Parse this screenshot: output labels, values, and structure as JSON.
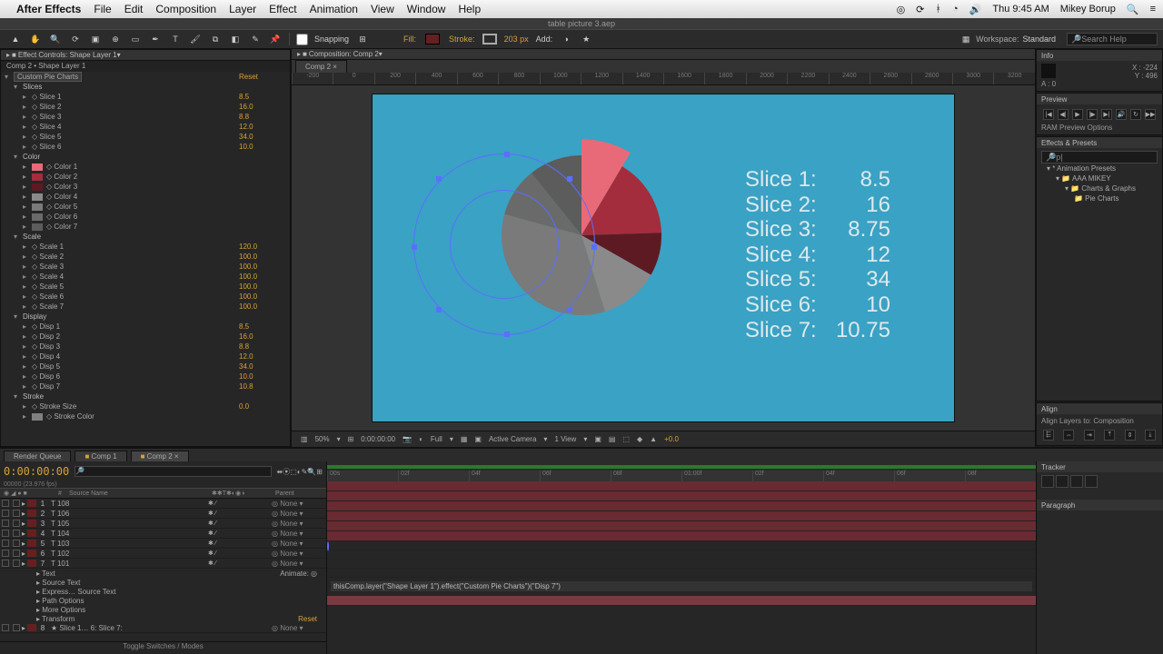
{
  "menubar": {
    "app": "After Effects",
    "items": [
      "File",
      "Edit",
      "Composition",
      "Layer",
      "Effect",
      "Animation",
      "View",
      "Window",
      "Help"
    ],
    "clock": "Thu 9:45 AM",
    "user": "Mikey Borup"
  },
  "filebar": {
    "title": "table picture 3.aep"
  },
  "toolbar": {
    "snapping": "Snapping",
    "fill": "Fill:",
    "stroke": "Stroke:",
    "stroke_px": "203 px",
    "add": "Add:",
    "workspace_lbl": "Workspace:",
    "workspace_val": "Standard",
    "search_ph": "Search Help"
  },
  "effect_controls": {
    "tab": "Effect Controls: Shape Layer 1",
    "head": "Comp 2 • Shape Layer 1",
    "effect_name": "Custom Pie Charts",
    "reset": "Reset",
    "groups": {
      "slices": {
        "label": "Slices",
        "rows": [
          {
            "name": "Slice 1",
            "val": "8.5"
          },
          {
            "name": "Slice 2",
            "val": "16.0"
          },
          {
            "name": "Slice 3",
            "val": "8.8"
          },
          {
            "name": "Slice 4",
            "val": "12.0"
          },
          {
            "name": "Slice 5",
            "val": "34.0"
          },
          {
            "name": "Slice 6",
            "val": "10.0"
          }
        ]
      },
      "colors": {
        "label": "Color",
        "rows": [
          {
            "name": "Color 1",
            "sw": "#e86a78"
          },
          {
            "name": "Color 2",
            "sw": "#a32d3c"
          },
          {
            "name": "Color 3",
            "sw": "#5d1a23"
          },
          {
            "name": "Color 4",
            "sw": "#8a8a8a"
          },
          {
            "name": "Color 5",
            "sw": "#7a7a7a"
          },
          {
            "name": "Color 6",
            "sw": "#6a6a6a"
          },
          {
            "name": "Color 7",
            "sw": "#5c5c5c"
          }
        ]
      },
      "scale": {
        "label": "Scale",
        "rows": [
          {
            "name": "Scale 1",
            "val": "120.0"
          },
          {
            "name": "Scale 2",
            "val": "100.0"
          },
          {
            "name": "Scale 3",
            "val": "100.0"
          },
          {
            "name": "Scale 4",
            "val": "100.0"
          },
          {
            "name": "Scale 5",
            "val": "100.0"
          },
          {
            "name": "Scale 6",
            "val": "100.0"
          },
          {
            "name": "Scale 7",
            "val": "100.0"
          }
        ]
      },
      "display": {
        "label": "Display",
        "rows": [
          {
            "name": "Disp 1",
            "val": "8.5"
          },
          {
            "name": "Disp 2",
            "val": "16.0"
          },
          {
            "name": "Disp 3",
            "val": "8.8"
          },
          {
            "name": "Disp 4",
            "val": "12.0"
          },
          {
            "name": "Disp 5",
            "val": "34.0"
          },
          {
            "name": "Disp 6",
            "val": "10.0"
          },
          {
            "name": "Disp 7",
            "val": "10.8"
          }
        ]
      },
      "stroke": {
        "label": "Stroke",
        "rows": [
          {
            "name": "Stroke Size",
            "val": "0.0"
          },
          {
            "name": "Stroke Color",
            "sw": "#808080"
          }
        ]
      }
    }
  },
  "comp": {
    "panel_tab": "Composition: Comp 2",
    "tab": "Comp 2",
    "ruler": [
      "-200",
      "0",
      "200",
      "400",
      "600",
      "800",
      "1000",
      "1200",
      "1400",
      "1600",
      "1800",
      "2000",
      "2200",
      "2400",
      "2600",
      "2800",
      "3000",
      "3200"
    ],
    "viewbar": {
      "zoom": "50%",
      "time": "0:00:00:00",
      "res": "Full",
      "camera": "Active Camera",
      "views": "1 View",
      "exp": "+0.0"
    }
  },
  "chart_data": {
    "type": "pie",
    "title": "",
    "series": [
      {
        "name": "Slice 1",
        "value": 8.5,
        "color": "#e86a78",
        "scale": 1.2
      },
      {
        "name": "Slice 2",
        "value": 16,
        "color": "#a32d3c",
        "scale": 1.0
      },
      {
        "name": "Slice 3",
        "value": 8.75,
        "color": "#5d1a23",
        "scale": 1.0
      },
      {
        "name": "Slice 4",
        "value": 12,
        "color": "#8a8a8a",
        "scale": 1.0
      },
      {
        "name": "Slice 5",
        "value": 34,
        "color": "#7a7a7a",
        "scale": 1.0
      },
      {
        "name": "Slice 6",
        "value": 10,
        "color": "#6a6a6a",
        "scale": 1.0
      },
      {
        "name": "Slice 7",
        "value": 10.75,
        "color": "#5c5c5c",
        "scale": 1.0
      }
    ],
    "legend": [
      {
        "label": "Slice 1:",
        "val": "8.5"
      },
      {
        "label": "Slice 2:",
        "val": "16"
      },
      {
        "label": "Slice 3:",
        "val": "8.75"
      },
      {
        "label": "Slice 4:",
        "val": "12"
      },
      {
        "label": "Slice 5:",
        "val": "34"
      },
      {
        "label": "Slice 6:",
        "val": "10"
      },
      {
        "label": "Slice 7:",
        "val": "10.75"
      }
    ]
  },
  "rightcol": {
    "info": {
      "title": "Info",
      "x": "X : -224",
      "y": "Y : 496",
      "a": "A : 0"
    },
    "preview": {
      "title": "Preview",
      "opts": "RAM Preview Options"
    },
    "effects": {
      "title": "Effects & Presets",
      "search": "p|",
      "tree": [
        {
          "l": 0,
          "t": "* Animation Presets"
        },
        {
          "l": 1,
          "t": "AAA MIKEY"
        },
        {
          "l": 2,
          "t": "Charts & Graphs"
        },
        {
          "l": 3,
          "t": "Pie Charts"
        }
      ]
    },
    "align": {
      "title": "Align",
      "lbl": "Align Layers to:",
      "val": "Composition"
    },
    "tracker": {
      "title": "Tracker"
    },
    "paragraph": {
      "title": "Paragraph"
    }
  },
  "timeline": {
    "tabs": [
      "Render Queue",
      "Comp 1",
      "Comp 2"
    ],
    "timecode": "0:00:00:00",
    "fps": "00000 (23.976 fps)",
    "hdr": {
      "source": "Source Name",
      "parent": "Parent"
    },
    "layers": [
      {
        "num": "1",
        "name": "108",
        "parent": "None"
      },
      {
        "num": "2",
        "name": "106",
        "parent": "None"
      },
      {
        "num": "3",
        "name": "105",
        "parent": "None"
      },
      {
        "num": "4",
        "name": "104",
        "parent": "None"
      },
      {
        "num": "5",
        "name": "103",
        "parent": "None"
      },
      {
        "num": "6",
        "name": "102",
        "parent": "None"
      },
      {
        "num": "7",
        "name": "101",
        "parent": "None"
      }
    ],
    "sub": [
      {
        "t": "Text",
        "extra": "Animate: ◎"
      },
      {
        "t": "Source Text"
      },
      {
        "t": "Express… Source Text"
      },
      {
        "t": "Path Options"
      },
      {
        "t": "More Options"
      },
      {
        "t": "Transform",
        "reset": "Reset"
      }
    ],
    "shape_layer": {
      "num": "8",
      "name": "Slice 1… 6: Slice 7:",
      "parent": "None"
    },
    "marks": [
      "00s",
      "02f",
      "04f",
      "06f",
      "08f",
      "01:00f",
      "02f",
      "04f",
      "06f",
      "08f"
    ],
    "expression": "thisComp.layer(\"Shape Layer 1\").effect(\"Custom Pie Charts\")(\"Disp 7\")",
    "toggle": "Toggle Switches / Modes"
  }
}
